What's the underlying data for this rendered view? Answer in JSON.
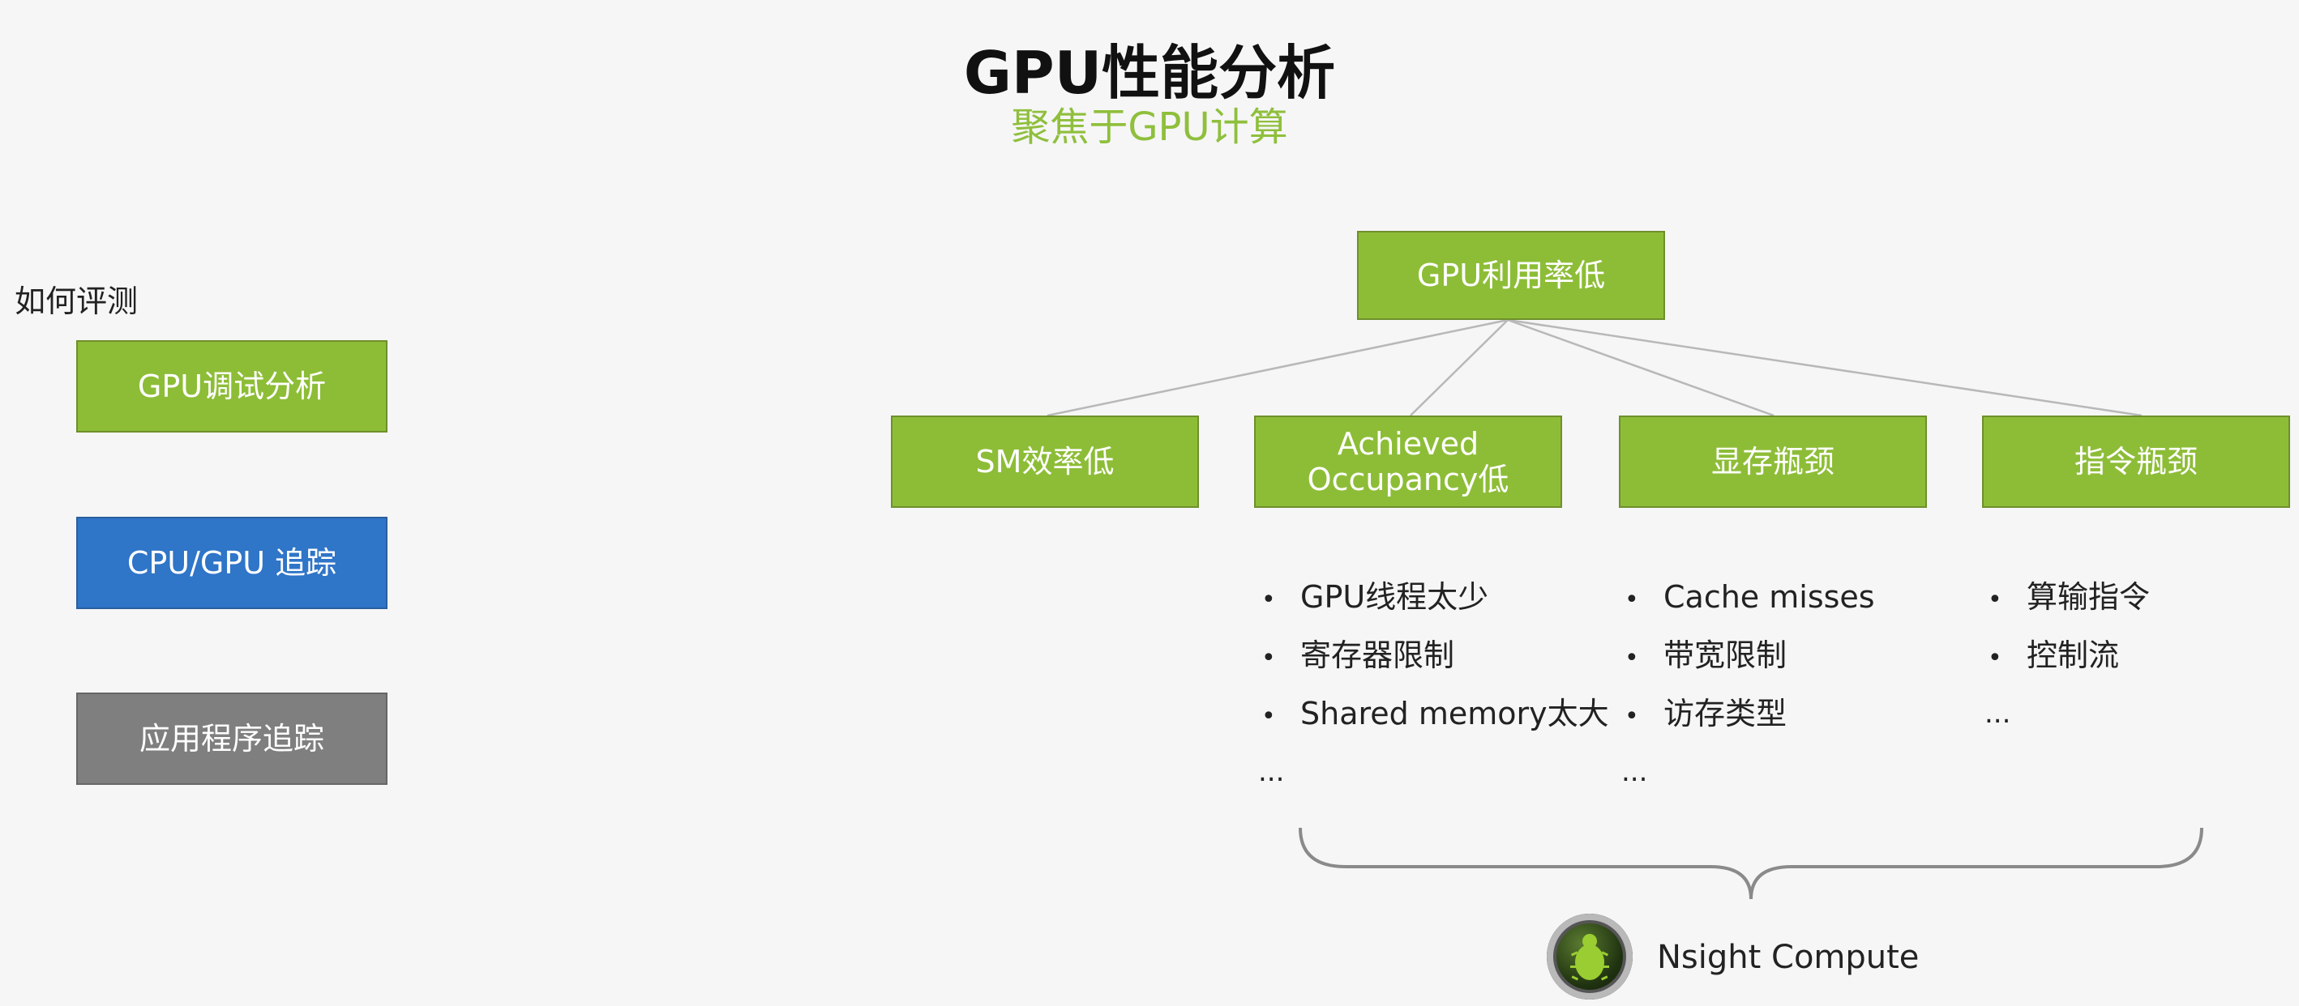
{
  "header": {
    "title": "GPU性能分析",
    "subtitle": "聚焦于GPU计算"
  },
  "sidebar": {
    "label": "如何评测",
    "items": [
      {
        "label": "GPU调试分析",
        "color": "#8dbd37"
      },
      {
        "label": "CPU/GPU 追踪",
        "color": "#2f75c8"
      },
      {
        "label": "应用程序追踪",
        "color": "#7f7f7f"
      }
    ]
  },
  "tree": {
    "root": "GPU利用率低",
    "children": [
      {
        "label": "SM效率低"
      },
      {
        "label_line1": "Achieved",
        "label_line2": "Occupancy低"
      },
      {
        "label": "显存瓶颈"
      },
      {
        "label": "指令瓶颈"
      }
    ]
  },
  "details": {
    "occupancy": [
      "GPU线程太少",
      "寄存器限制",
      "Shared memory太大",
      "..."
    ],
    "memory": [
      "Cache misses",
      "带宽限制",
      "访存类型",
      "..."
    ],
    "instruction": [
      "算输指令",
      "控制流",
      "..."
    ]
  },
  "tool": {
    "icon": "nsight-compute-logo-icon",
    "name": "Nsight Compute"
  },
  "colors": {
    "accent_green": "#8dbd37",
    "subtitle_green": "#8fbf3c",
    "blue": "#2f75c8",
    "gray": "#7f7f7f"
  }
}
